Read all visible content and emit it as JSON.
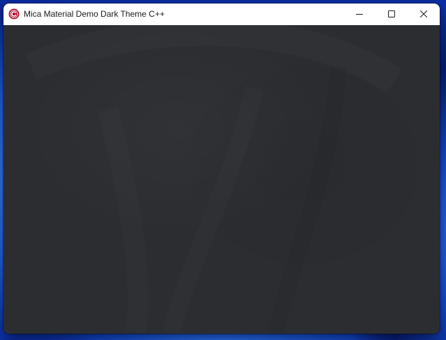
{
  "window": {
    "title": "Mica Material Demo Dark Theme C++",
    "app_icon": "app-c-logo-icon",
    "caption_buttons": {
      "minimize_icon": "minimize-icon",
      "maximize_icon": "maximize-icon",
      "close_icon": "close-icon"
    }
  },
  "colors": {
    "titlebar": "#ffffff",
    "client_area": "#2b2d31",
    "app_icon_accent": "#b0122c",
    "desktop_accent": "#1f5fe0"
  }
}
